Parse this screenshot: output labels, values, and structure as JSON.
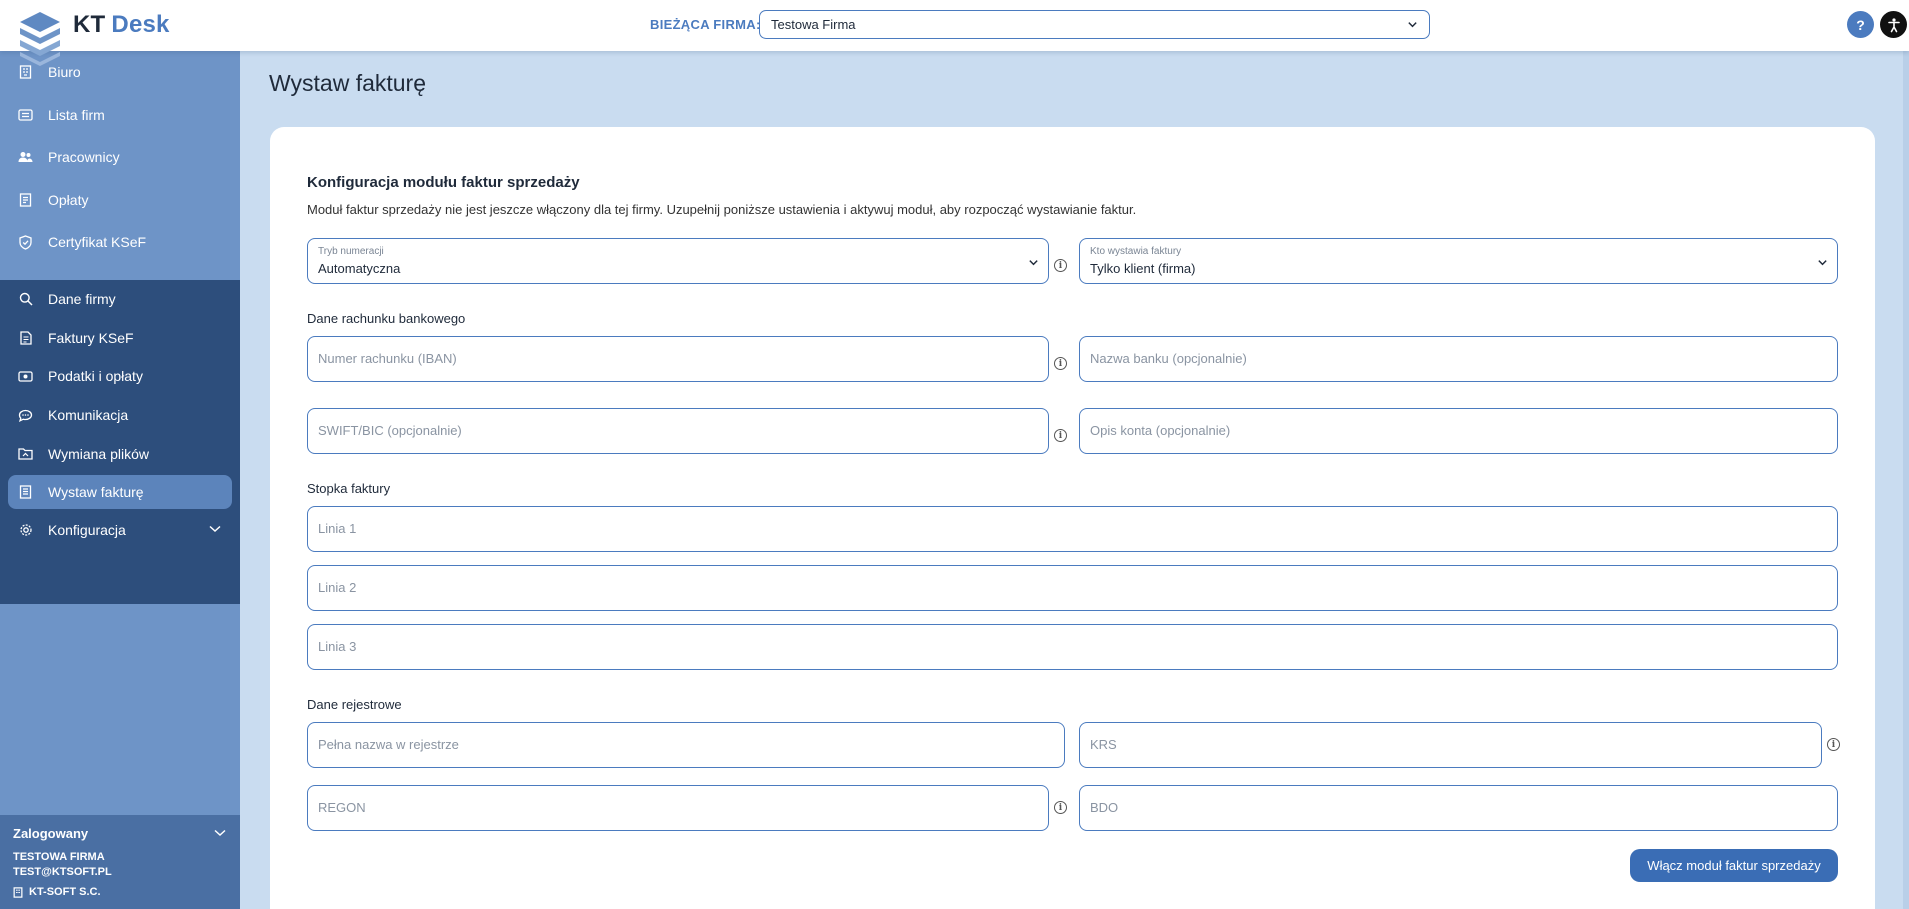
{
  "header": {
    "brand_kt": "KT",
    "brand_desk": "Desk",
    "company_label": "BIEŻĄCA FIRMA:",
    "company_value": "Testowa Firma",
    "help_label": "?"
  },
  "sidebar": {
    "top_items": [
      {
        "label": "Biuro",
        "icon": "building-icon"
      },
      {
        "label": "Lista firm",
        "icon": "list-icon"
      },
      {
        "label": "Pracownicy",
        "icon": "users-icon"
      },
      {
        "label": "Opłaty",
        "icon": "receipt-icon"
      },
      {
        "label": "Certyfikat KSeF",
        "icon": "shield-icon"
      }
    ],
    "company_items": [
      {
        "label": "Dane firmy",
        "icon": "search-icon"
      },
      {
        "label": "Faktury KSeF",
        "icon": "document-icon"
      },
      {
        "label": "Podatki i opłaty",
        "icon": "money-icon"
      },
      {
        "label": "Komunikacja",
        "icon": "chat-icon"
      },
      {
        "label": "Wymiana plików",
        "icon": "folder-icon"
      },
      {
        "label": "Wystaw fakturę",
        "icon": "invoice-icon",
        "active": true
      },
      {
        "label": "Konfiguracja",
        "icon": "gear-icon"
      }
    ],
    "user": {
      "title": "Zalogowany",
      "company": "TESTOWA FIRMA",
      "email": "TEST@KTSOFT.PL",
      "org": "KT-SOFT S.C."
    }
  },
  "main": {
    "page_title": "Wystaw fakturę",
    "section_title": "Konfiguracja modułu faktur sprzedaży",
    "section_desc": "Moduł faktur sprzedaży nie jest jeszcze włączony dla tej firmy. Uzupełnij poniższe ustawienia i aktywuj moduł, aby rozpocząć wystawianie faktur.",
    "numbering_label": "Tryb numeracji",
    "numbering_value": "Automatyczna",
    "issuer_label": "Kto wystawia faktury",
    "issuer_value": "Tylko klient (firma)",
    "bank_section": "Dane rachunku bankowego",
    "iban_placeholder": "Numer rachunku (IBAN)",
    "bank_name_placeholder": "Nazwa banku (opcjonalnie)",
    "swift_placeholder": "SWIFT/BIC (opcjonalnie)",
    "account_desc_placeholder": "Opis konta (opcjonalnie)",
    "footer_section": "Stopka faktury",
    "line1_placeholder": "Linia 1",
    "line2_placeholder": "Linia 2",
    "line3_placeholder": "Linia 3",
    "registry_section": "Dane rejestrowe",
    "full_name_placeholder": "Pełna nazwa w rejestrze",
    "krs_placeholder": "KRS",
    "regon_placeholder": "REGON",
    "bdo_placeholder": "BDO",
    "info_glyph": "i",
    "enable_button": "Włącz moduł faktur sprzedaży"
  },
  "colors": {
    "accent": "#4b7bbf",
    "sidebar": "#6e94c7",
    "sidebar_dark": "#2d4e7c",
    "button": "#3a6db5"
  }
}
